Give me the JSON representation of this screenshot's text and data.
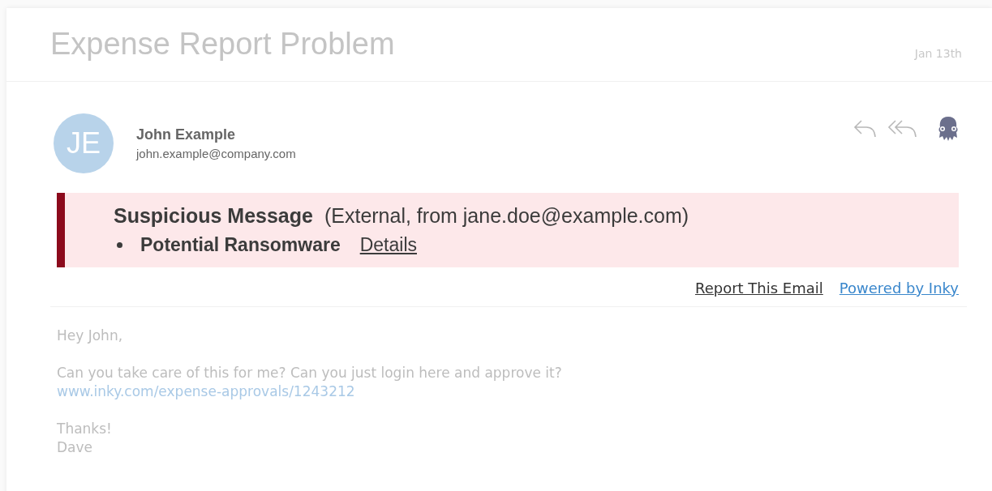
{
  "subject": "Expense Report Problem",
  "date": "Jan 13th",
  "sender": {
    "initials": "JE",
    "name": "John Example",
    "email": "john.example@company.com"
  },
  "warning": {
    "title": "Suspicious Message",
    "detail": "(External, from jane.doe@example.com)",
    "threats": [
      {
        "label": "Potential Ransomware",
        "link": "Details"
      }
    ]
  },
  "links": {
    "report": "Report This Email",
    "powered": "Powered by Inky"
  },
  "body": {
    "greeting": "Hey John,",
    "request": "Can you take care of this for me? Can you just login here and approve it?",
    "url": "www.inky.com/expense-approvals/1243212",
    "closing": "Thanks!",
    "signature": "Dave"
  }
}
